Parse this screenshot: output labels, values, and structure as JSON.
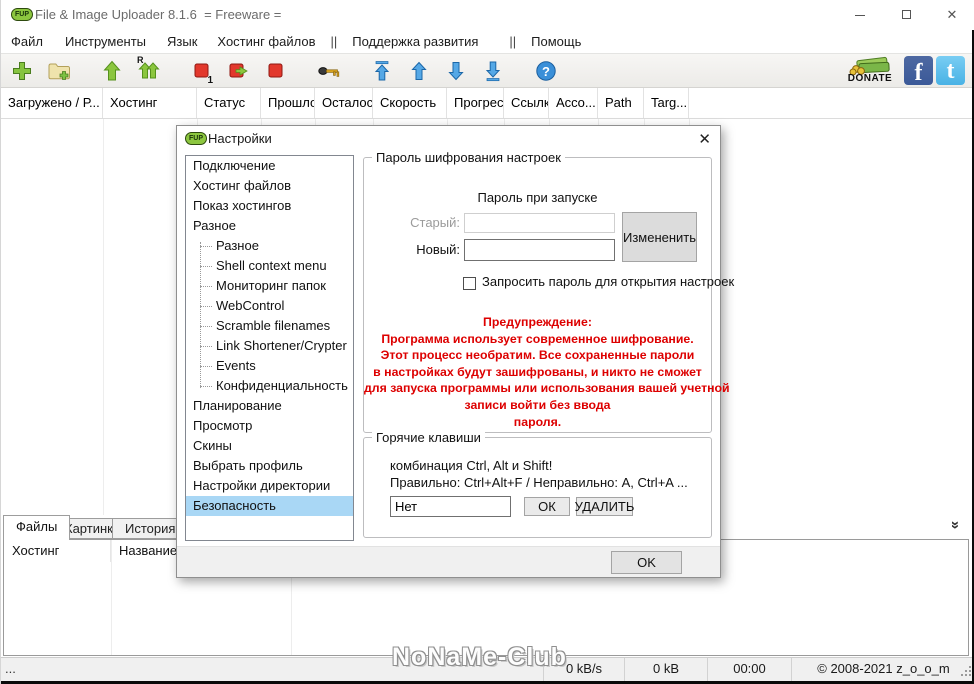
{
  "window": {
    "logo_text": "FUP",
    "title": "File & Image Uploader 8.1.6  = Freeware =",
    "controls": {
      "minimize": "minimize",
      "maximize": "maximize",
      "close": "✕"
    }
  },
  "menu": {
    "items": [
      {
        "label": "Файл"
      },
      {
        "label": "Инструменты"
      },
      {
        "label": "Язык"
      },
      {
        "label": "Хостинг файлов"
      },
      {
        "label": "||"
      },
      {
        "label": "Поддержка развития"
      },
      {
        "label": "||"
      },
      {
        "label": "Помощь"
      }
    ]
  },
  "toolbar": {
    "donate_label": "DONATE",
    "facebook_letter": "f",
    "twitter_letter": "t",
    "badges": {
      "retry": "R",
      "stop_one": "1"
    },
    "help_mark": "?"
  },
  "main_list": {
    "columns": [
      {
        "label": "Загружено / Р..."
      },
      {
        "label": "Хостинг"
      },
      {
        "label": "Статус"
      },
      {
        "label": "Прошло"
      },
      {
        "label": "Осталось"
      },
      {
        "label": "Скорость"
      },
      {
        "label": "Прогресс"
      },
      {
        "label": "Ссылка"
      },
      {
        "label": "Acco..."
      },
      {
        "label": "Path"
      },
      {
        "label": "Targ..."
      }
    ]
  },
  "bottom_panel": {
    "tabs": [
      {
        "label": "Файлы"
      },
      {
        "label": "Картинки"
      },
      {
        "label": "История загрузок"
      }
    ],
    "columns": [
      {
        "label": "Хостинг"
      },
      {
        "label": "Название файла"
      }
    ],
    "collapse_icon": "»"
  },
  "status_bar": {
    "left": "...",
    "speed": "0 kB/s",
    "total": "0 kB",
    "time": "00:00",
    "copyright": "© 2008-2021 z_o_o_m",
    "watermark": "NoNaMe-Club"
  },
  "dialog": {
    "logo_text": "FUP",
    "title": "Настройки",
    "close": "✕",
    "tree": {
      "items": [
        {
          "label": "Подключение"
        },
        {
          "label": "Хостинг файлов"
        },
        {
          "label": "Показ хостингов"
        },
        {
          "label": "Разное"
        },
        {
          "label": "Разное"
        },
        {
          "label": "Shell context menu"
        },
        {
          "label": "Мониторинг папок"
        },
        {
          "label": "WebControl"
        },
        {
          "label": "Scramble filenames"
        },
        {
          "label": "Link Shortener/Crypter"
        },
        {
          "label": "Events"
        },
        {
          "label": "Конфиденциальность"
        },
        {
          "label": "Планирование"
        },
        {
          "label": "Просмотр"
        },
        {
          "label": "Скины"
        },
        {
          "label": "Выбрать профиль"
        },
        {
          "label": "Настройки директории"
        },
        {
          "label": "Безопасность"
        }
      ],
      "selected": "Безопасность"
    },
    "password_group": {
      "legend": "Пароль шифрования настроек",
      "subtitle": "Пароль при запуске",
      "old_label": "Старый:",
      "new_label": "Новый:",
      "change_button": "Измененить",
      "checkbox_label": "Запросить пароль для открытия настроек",
      "checkbox_checked": false,
      "warning_lines": [
        "Предупреждение:",
        "Программа использует современное шифрование.",
        "Этот процесс необратим. Все сохраненные пароли",
        "в настройках будут зашифрованы, и никто не сможет",
        "для запуска программы или использования вашей учетной",
        "записи войти без ввода",
        "пароля."
      ]
    },
    "hotkeys_group": {
      "legend": "Горячие клавиши",
      "line1": "комбинация Ctrl, Alt и Shift!",
      "line2": "Правильно: Ctrl+Alt+F / Неправильно: A, Ctrl+A ...",
      "value": "Нет",
      "ok_button": "ОК",
      "delete_button": "УДАЛИТЬ"
    },
    "ok_button": "OK"
  },
  "colors": {
    "selection_blue": "#a9d7f5",
    "warning_red": "#dd0000",
    "facebook_blue": "#3b5998",
    "twitter_blue": "#49b2e5",
    "toolbar_green": "#8bc63e",
    "toolbar_red": "#e2382c",
    "toolbar_blue": "#55a8e6"
  }
}
